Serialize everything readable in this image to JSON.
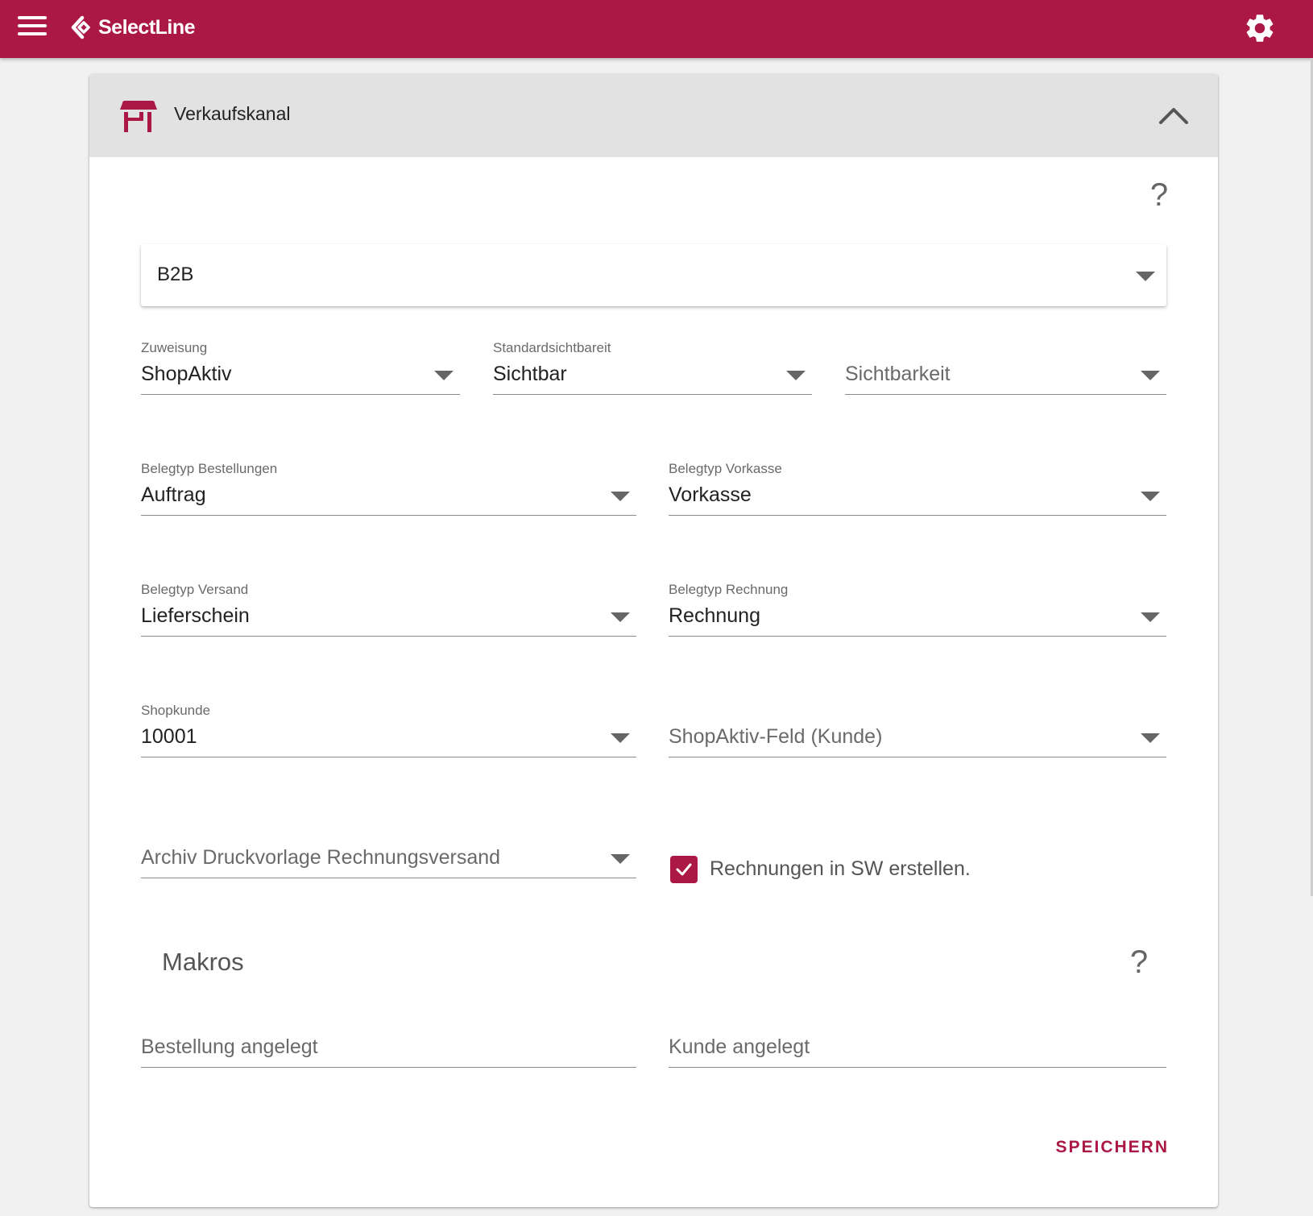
{
  "app": {
    "brand": "SelectLine",
    "accent_color": "#ab1846"
  },
  "panel": {
    "title": "Verkaufskanal",
    "channel_select": {
      "value": "B2B"
    }
  },
  "fields": {
    "zuweisung": {
      "label": "Zuweisung",
      "value": "ShopAktiv"
    },
    "standardsichtbarkeit": {
      "label": "Standardsichtbareit",
      "value": "Sichtbar"
    },
    "sichtbarkeit": {
      "placeholder": "Sichtbarkeit"
    },
    "belegtyp_bestellungen": {
      "label": "Belegtyp Bestellungen",
      "value": "Auftrag"
    },
    "belegtyp_vorkasse": {
      "label": "Belegtyp Vorkasse",
      "value": "Vorkasse"
    },
    "belegtyp_versand": {
      "label": "Belegtyp Versand",
      "value": "Lieferschein"
    },
    "belegtyp_rechnung": {
      "label": "Belegtyp Rechnung",
      "value": "Rechnung"
    },
    "shopkunde": {
      "label": "Shopkunde",
      "value": "10001"
    },
    "shopaktiv_feld": {
      "placeholder": "ShopAktiv-Feld (Kunde)"
    },
    "archiv_druckvorlage": {
      "placeholder": "Archiv Druckvorlage Rechnungsversand"
    }
  },
  "checkbox": {
    "label": "Rechnungen in SW erstellen.",
    "checked": true
  },
  "makros": {
    "title": "Makros",
    "bestellung_angelegt": {
      "placeholder": "Bestellung angelegt"
    },
    "kunde_angelegt": {
      "placeholder": "Kunde angelegt"
    }
  },
  "help_label": "?",
  "save_label": "SPEICHERN",
  "icons": [
    "menu-icon",
    "selectline-logo-icon",
    "gear-icon",
    "store-icon",
    "chevron-up-icon",
    "help-icon",
    "caret-down-icon",
    "checkmark-icon"
  ]
}
